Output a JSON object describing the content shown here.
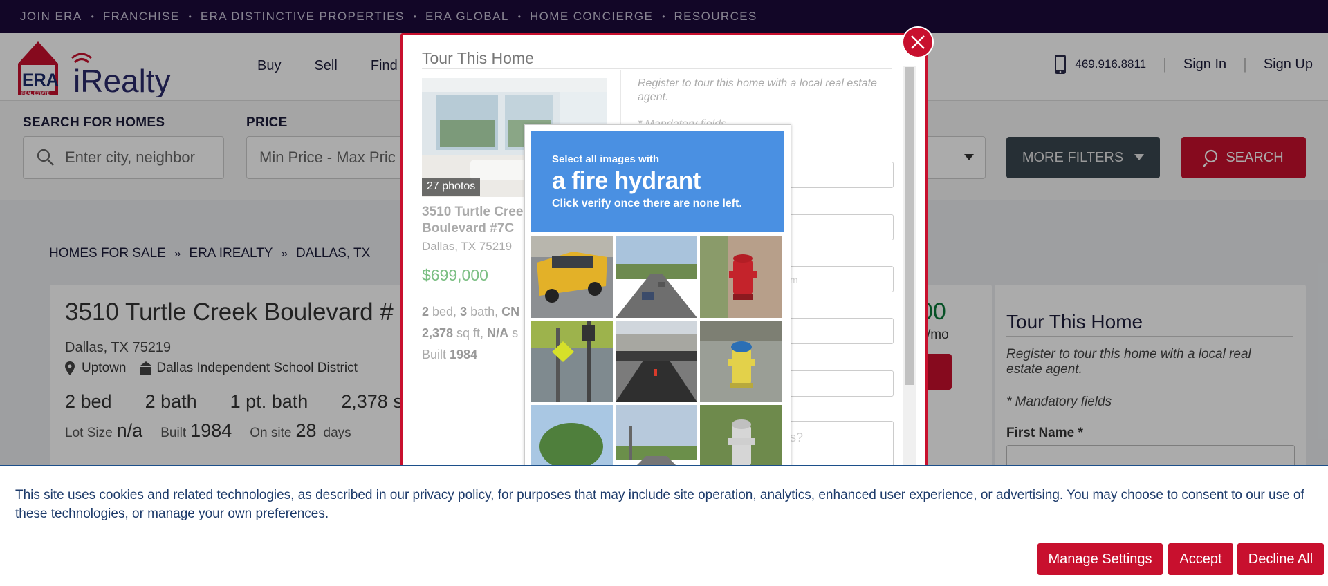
{
  "topbar": {
    "items": [
      "JOIN ERA",
      "FRANCHISE",
      "ERA DISTINCTIVE PROPERTIES",
      "ERA GLOBAL",
      "HOME CONCIERGE",
      "RESOURCES"
    ]
  },
  "header": {
    "logo_era": "ERA",
    "logo_sub": "REAL ESTATE",
    "logo_realty": "iRealty",
    "nav": [
      "Buy",
      "Sell",
      "Find a"
    ],
    "phone": "469.916.8811",
    "sign_in": "Sign In",
    "sign_up": "Sign Up"
  },
  "search": {
    "label_homes": "SEARCH FOR HOMES",
    "placeholder": "Enter city, neighbor",
    "label_price": "PRICE",
    "price_value": "Min Price  -  Max Pric",
    "more_filters": "MORE FILTERS",
    "search_btn": "SEARCH"
  },
  "breadcrumb": [
    "HOMES FOR SALE",
    "ERA IREALTY",
    "DALLAS, TX"
  ],
  "listing": {
    "address": "3510 Turtle Creek Boulevard #",
    "city": "Dallas, TX 75219",
    "neighborhood": "Uptown",
    "school": "Dallas Independent School District",
    "beds": "2 bed",
    "baths": "2 bath",
    "half_bath": "1 pt. bath",
    "sqft": "2,378 sq f",
    "lot_label": "Lot Size",
    "lot_value": "n/a",
    "built_label": "Built",
    "built_value": "1984",
    "onsite_label": "On site",
    "onsite_value": "28",
    "onsite_unit": "days",
    "price_fragment": "00",
    "mo_fragment": "/mo"
  },
  "sidebar": {
    "title": "Tour This Home",
    "subtitle": "Register to tour this home with a local real estate agent.",
    "mandatory": "* Mandatory fields",
    "first_name": "First Name *"
  },
  "modal": {
    "title": "Tour This Home",
    "photo_count": "27 photos",
    "address": "3510 Turtle Cree Boulevard #7C",
    "city": "Dallas, TX 75219",
    "price": "$699,000",
    "spec_beds_num": "2",
    "spec_beds": " bed, ",
    "spec_bath_num": "3",
    "spec_bath": " bath, ",
    "spec_cn": "CN",
    "spec_sqft_num": "2,378",
    "spec_sqft": " sq ft, ",
    "spec_na": "N/A",
    "spec_s": " s",
    "spec_built": "Built ",
    "spec_built_year": "1984",
    "register": "Register to tour this home with a local real estate agent.",
    "mandatory": "* Mandatory fields",
    "placeholder_email": "m",
    "placeholder_question": "s?"
  },
  "captcha": {
    "line1": "Select all images with",
    "line2": "a fire hydrant",
    "line3": "Click verify once there are none left."
  },
  "cookie": {
    "text": "This site uses cookies and related technologies, as described in our privacy policy, for purposes that may include site operation, analytics, enhanced user experience, or advertising. You may choose to consent to our use of these technologies, or manage your own preferences.",
    "manage": "Manage Settings",
    "accept": "Accept",
    "decline": "Decline All"
  },
  "colors": {
    "brand_red": "#c8102e",
    "topbar": "#1c0a3b",
    "captcha_blue": "#4a90e2",
    "price_green": "#7cbf84"
  }
}
